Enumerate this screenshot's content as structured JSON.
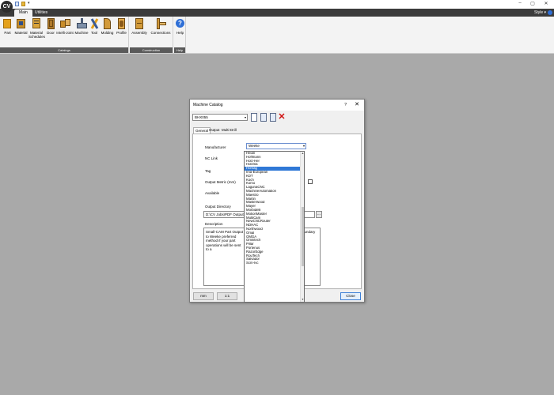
{
  "app": {
    "logo_text": "CV",
    "window_controls": [
      "–",
      "▢",
      "✕"
    ]
  },
  "ribbon_tabs": [
    {
      "label": "Main",
      "active": true
    },
    {
      "label": "Utilities",
      "active": false
    }
  ],
  "style_menu": "Style ▾",
  "ribbon": {
    "groups": [
      {
        "label": "Catalogs",
        "buttons": [
          {
            "label": "Part",
            "icon": "part-icon"
          },
          {
            "label": "Material",
            "icon": "material-icon"
          },
          {
            "label": "Material Schedules",
            "icon": "material-schedules-icon"
          },
          {
            "label": "Door",
            "icon": "door-icon"
          },
          {
            "label": "Intelli-Joint",
            "icon": "intelli-joint-icon"
          },
          {
            "label": "Machine",
            "icon": "machine-icon"
          },
          {
            "label": "Tool",
            "icon": "tool-icon"
          },
          {
            "label": "Molding",
            "icon": "molding-icon"
          },
          {
            "label": "Profile",
            "icon": "profile-icon"
          }
        ]
      },
      {
        "label": "Construction",
        "buttons": [
          {
            "label": "Assembly",
            "icon": "assembly-icon"
          },
          {
            "label": "Connections",
            "icon": "connections-icon"
          }
        ]
      },
      {
        "label": "Help",
        "buttons": [
          {
            "label": "Help",
            "icon": "help-icon"
          }
        ]
      }
    ]
  },
  "dialog": {
    "title": "Machine Catalog",
    "help_glyph": "?",
    "close_glyph": "✕",
    "machine_value": "BHX055",
    "tabs": [
      {
        "label": "General",
        "active": true
      },
      {
        "label": "Output",
        "active": false
      },
      {
        "label": "Multi-Drill",
        "active": false
      }
    ],
    "fields": {
      "manufacturer_label": "Manufacturer",
      "manufacturer_value": "Weeke",
      "nc_link_label": "NC Link",
      "tag_label": "Tag",
      "output_metric_label": "Output Metric (mm)",
      "available_label": "Available",
      "output_directory_label": "Output Directory",
      "output_directory_value": "D:\\CV Jobs\\PDF Output\\BHX055",
      "browse_label": "...",
      "description_label": "Description",
      "description_text": "Small-CAM Part Output to Weeke preferred method if your part operations will be sent to a",
      "description_tail": "the boundary"
    },
    "buttons": {
      "mm": "mm",
      "one_one": "1:1",
      "close": "Close"
    }
  },
  "manufacturer_options": [
    "Heian",
    "Hoffmann",
    "Holz-Her",
    "Holzma",
    "Homag",
    "Ima-European",
    "KDT",
    "Koch",
    "Komo",
    "LagunaCNC",
    "MachineAutomation",
    "Maestro",
    "Martin",
    "Masterwood",
    "Mayer",
    "Morbidelli",
    "MotionMaster",
    "MultiCam",
    "NewCNCRouter",
    "NDHAC",
    "Northwood",
    "Omal",
    "OMGA",
    "Omnitech",
    "Pillar",
    "Portenus",
    "RazorEdge",
    "RouTech",
    "Salvador",
    "Scm-Ivc"
  ],
  "selected_option_index": 4,
  "colors": {
    "accent": "#2f78d6",
    "delete_red": "#d01010",
    "ribbon_dark": "#3b3b3b"
  }
}
